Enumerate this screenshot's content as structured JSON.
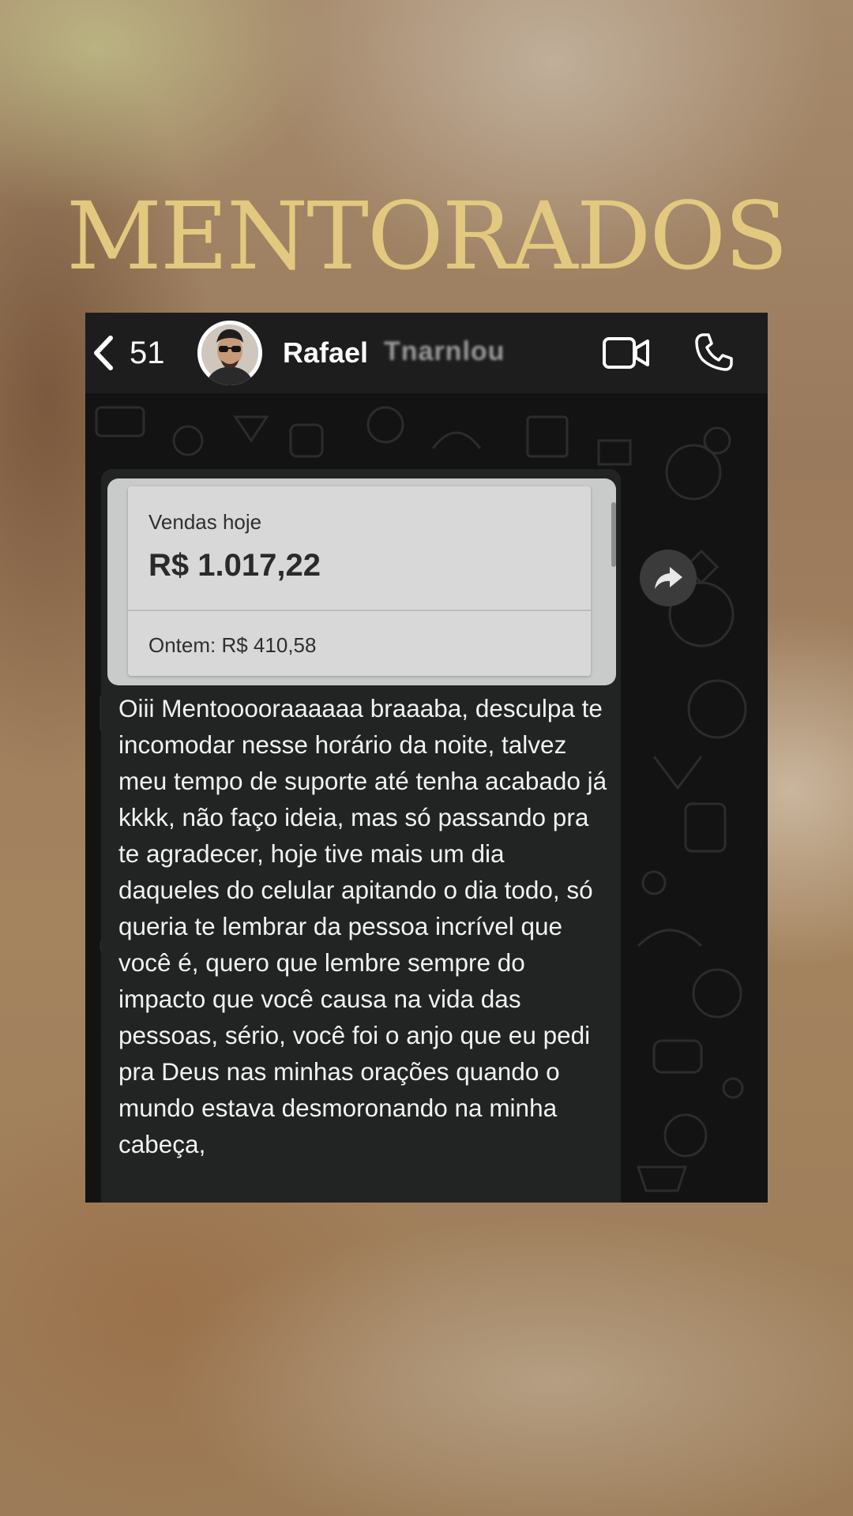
{
  "headline": "MENTORADOS",
  "chat": {
    "back_count": "51",
    "contact_name": "Rafael",
    "contact_surname_obscured": "Tnarnlou",
    "icons": {
      "back": "chevron-left-icon",
      "video": "video-call-icon",
      "phone": "phone-call-icon",
      "forward": "forward-icon"
    },
    "card": {
      "label": "Vendas hoje",
      "amount": "R$ 1.017,22",
      "yesterday": "Ontem: R$ 410,58"
    },
    "message": "Oiii Mentooooraaaaaa braaaba, desculpa te incomodar nesse horário da noite, talvez meu tempo de suporte até tenha acabado já kkkk, não faço ideia, mas só passando pra te agradecer, hoje tive mais um dia daqueles do celular apitando o dia todo, só queria te lembrar da pessoa incrível que você é, quero que lembre sempre do impacto que você causa na vida das pessoas, sério, você foi o anjo que eu pedi pra Deus nas minhas orações quando o mundo estava desmoronando na minha cabeça,"
  },
  "colors": {
    "headline": "#e2c97f",
    "chat_background": "#131313",
    "bubble": "#222323",
    "card": "#d8d8d8"
  }
}
